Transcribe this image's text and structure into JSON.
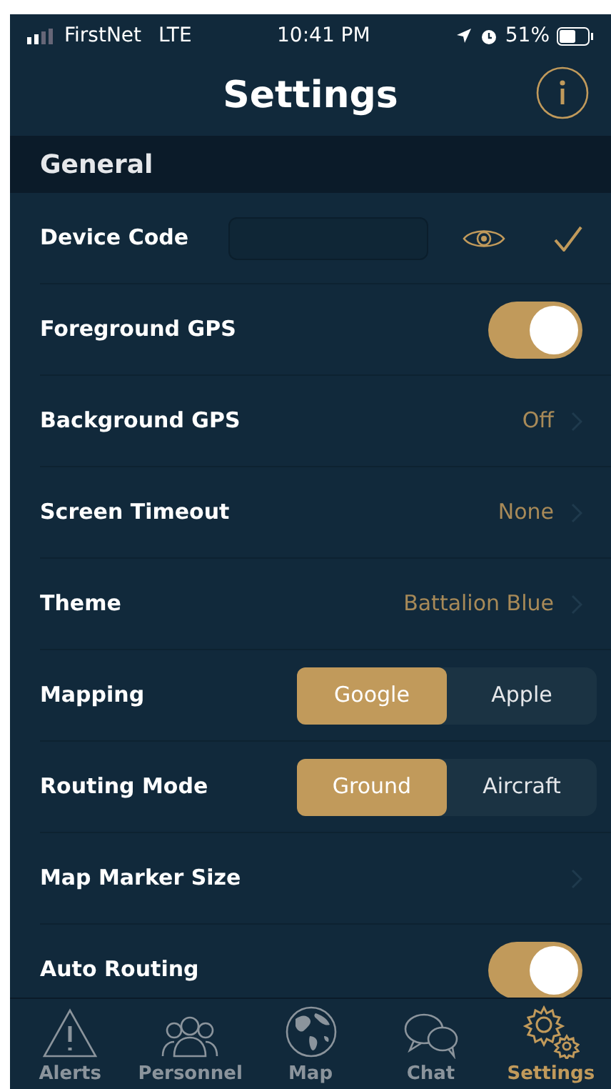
{
  "status_bar": {
    "carrier": "FirstNet",
    "network": "LTE",
    "time": "10:41 PM",
    "battery": "51%"
  },
  "header": {
    "title": "Settings"
  },
  "section": {
    "title": "General"
  },
  "rows": [
    {
      "kind": "field",
      "label": "Device Code"
    },
    {
      "kind": "toggle",
      "label": "Foreground GPS",
      "on": true
    },
    {
      "kind": "value",
      "label": "Background GPS",
      "value": "Off"
    },
    {
      "kind": "value",
      "label": "Screen Timeout",
      "value": "None"
    },
    {
      "kind": "value",
      "label": "Theme",
      "value": "Battalion Blue"
    },
    {
      "kind": "segmented",
      "label": "Mapping",
      "options": [
        {
          "label": "Google",
          "selected": true
        },
        {
          "label": "Apple",
          "selected": false
        }
      ]
    },
    {
      "kind": "segmented",
      "label": "Routing Mode",
      "options": [
        {
          "label": "Ground",
          "selected": true
        },
        {
          "label": "Aircraft",
          "selected": false
        }
      ]
    },
    {
      "kind": "value",
      "label": "Map Marker Size"
    },
    {
      "kind": "toggle",
      "label": "Auto Routing",
      "on": true
    }
  ],
  "tabs": [
    {
      "kind": "alert",
      "label": "Alerts",
      "selected": false
    },
    {
      "kind": "people",
      "label": "Personnel",
      "selected": false
    },
    {
      "kind": "globe",
      "label": "Map",
      "selected": false
    },
    {
      "kind": "chat",
      "label": "Chat",
      "selected": false
    },
    {
      "kind": "gear",
      "label": "Settings",
      "selected": true
    }
  ]
}
